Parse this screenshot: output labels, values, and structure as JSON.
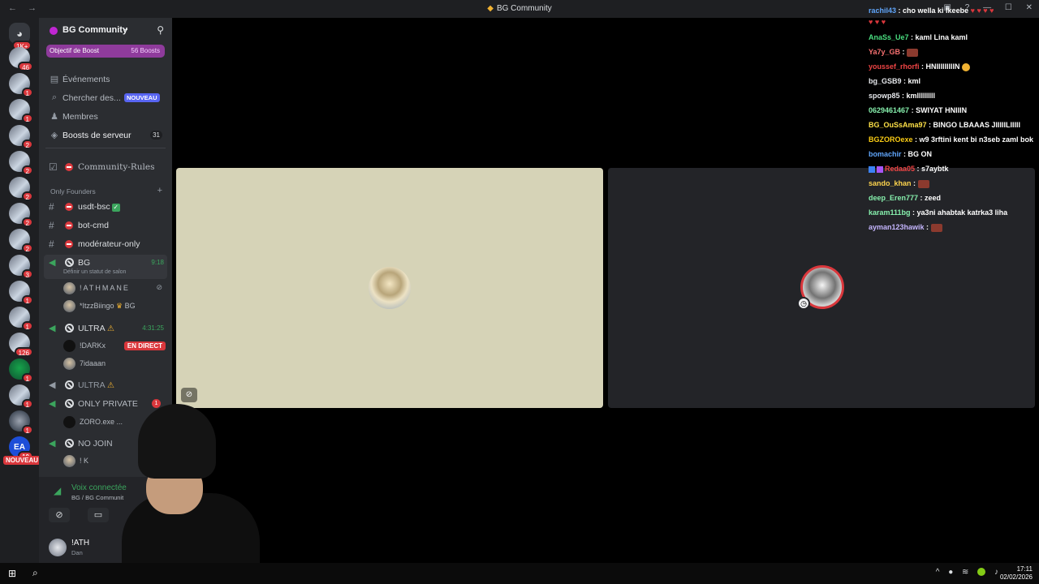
{
  "window": {
    "title": "BG Community"
  },
  "guild_badges": [
    "1K+",
    "46",
    "1",
    "1",
    "2",
    "2",
    "2",
    "2",
    "2",
    "3",
    "1",
    "1",
    "126",
    "1",
    "1",
    "1",
    "10"
  ],
  "guild_new_label": "NOUVEAU",
  "server": {
    "name": "BG Community",
    "boost_goal": "Objectif de Boost",
    "boost_count": "56 Boosts"
  },
  "nav": {
    "events": "Événements",
    "search": "Chercher des...",
    "search_badge": "NOUVEAU",
    "members": "Membres",
    "boosts": "Boosts de serveur",
    "boosts_count": "31",
    "rules": "Community-Rules"
  },
  "category": {
    "founders": "Only Founders"
  },
  "text_channels": [
    "usdt-bsc",
    "bot-cmd",
    "modérateur-only"
  ],
  "voice": {
    "bg": {
      "name": "BG",
      "time": "9:18",
      "status": "Définir un statut de salon"
    },
    "bg_users": [
      {
        "name": "!ATHMANE"
      },
      {
        "name": "*ItzzBiingo",
        "tag": "BG"
      }
    ],
    "ultra1": {
      "name": "ULTRA",
      "time": "4:31:25"
    },
    "ultra1_users": [
      {
        "name": "!DARKx",
        "live": "EN DIRECT"
      },
      {
        "name": "7idaaan"
      }
    ],
    "ultra2": {
      "name": "ULTRA"
    },
    "private": {
      "name": "ONLY PRIVATE",
      "count": "1"
    },
    "private_users": [
      {
        "name": "ZORO.exe ..."
      }
    ],
    "nojoin": {
      "name": "NO JOIN"
    },
    "nojoin_users": [
      {
        "name": "! K"
      }
    ]
  },
  "voice_panel": {
    "title": "Voix connectée",
    "subtitle": "BG / BG Communit"
  },
  "user_panel": {
    "name": "!ATH",
    "status": "Dan"
  },
  "chat": [
    {
      "user": "rachil43",
      "text": "cho wella ki lkeebe",
      "color": "#60a5fa"
    },
    {
      "user": "AnaSs_Ue7",
      "text": "kaml Lina kaml",
      "color": "#4ade80"
    },
    {
      "user": "Ya7y_GB",
      "text": "",
      "color": "#f87171"
    },
    {
      "user": "youssef_rhorfi",
      "text": "HNIIIIIIIIIN",
      "color": "#ef4444"
    },
    {
      "user": "bg_GSB9",
      "text": "kml",
      "color": "#e5e7eb"
    },
    {
      "user": "spowp85",
      "text": "kmlllllllll",
      "color": "#e5e7eb"
    },
    {
      "user": "0629461467",
      "text": "SWIYAT HNIIIN",
      "color": "#86efac"
    },
    {
      "user": "BG_OuSsAma97",
      "text": "BINGO LBAAAS JIIIIILIIIII",
      "color": "#fde047"
    },
    {
      "user": "BGZOROexe",
      "text": "w9 3rftini kent bi n3seb zaml bok",
      "color": "#facc15"
    },
    {
      "user": "bomachir",
      "text": "BG ON",
      "color": "#60a5fa"
    },
    {
      "user": "Redaa05",
      "text": "s7aybtk",
      "color": "#ef4444"
    },
    {
      "user": "sando_khan",
      "text": "",
      "color": "#fcd34d"
    },
    {
      "user": "deep_Eren777",
      "text": "zeed",
      "color": "#86efac"
    },
    {
      "user": "karam111bg",
      "text": "ya3ni ahabtak katrka3 liha",
      "color": "#86efac"
    },
    {
      "user": "ayman123hawik",
      "text": "",
      "color": "#c4b5fd"
    }
  ],
  "taskbar": {
    "time": "17:11",
    "date": "02/02/2026"
  }
}
